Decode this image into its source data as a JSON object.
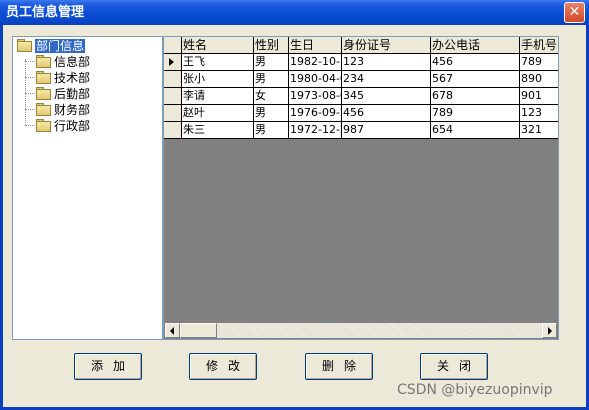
{
  "window": {
    "title": "员工信息管理",
    "close_glyph": "✕"
  },
  "tree": {
    "root": "部门信息",
    "children": [
      "信息部",
      "技术部",
      "后勤部",
      "财务部",
      "行政部"
    ]
  },
  "grid": {
    "columns": [
      "姓名",
      "性别",
      "生日",
      "身份证号",
      "办公电话",
      "手机号"
    ],
    "rows": [
      [
        "王飞",
        "男",
        "1982-10-1",
        "123",
        "456",
        "789"
      ],
      [
        "张小",
        "男",
        "1980-04-0",
        "234",
        "567",
        "890"
      ],
      [
        "李请",
        "女",
        "1973-08-0",
        "345",
        "678",
        "901"
      ],
      [
        "赵叶",
        "男",
        "1976-09-2",
        "456",
        "789",
        "123"
      ],
      [
        "朱三",
        "男",
        "1972-12-2",
        "987",
        "654",
        "321"
      ]
    ]
  },
  "buttons": {
    "add": "添加",
    "edit": "修改",
    "delete": "删除",
    "close": "关闭"
  },
  "watermark": "CSDN @biyezuopinvip",
  "colors": {
    "titlebar": "#0a4ed6",
    "selection": "#316ac5",
    "close": "#d04a2a"
  }
}
